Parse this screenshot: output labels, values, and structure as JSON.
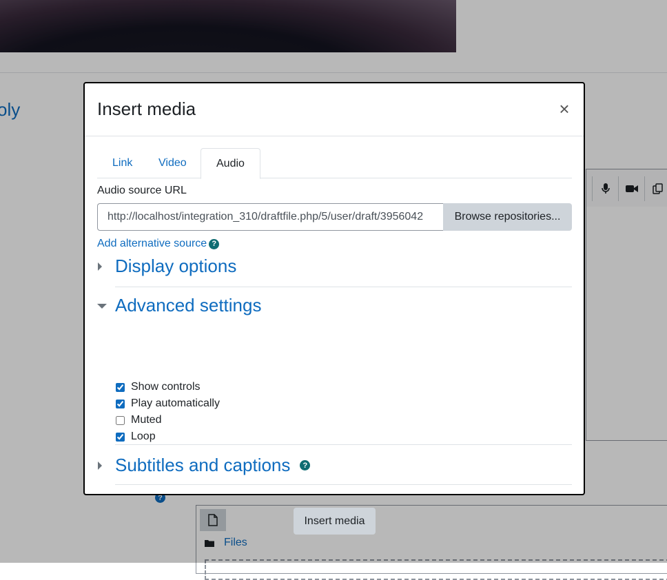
{
  "background": {
    "link_partial": "oly",
    "help_glyph": "?",
    "file_manager": {
      "files_link": "Files"
    },
    "toolbar_icons": [
      "microphone-icon",
      "video-camera-icon",
      "copy-icon"
    ]
  },
  "modal": {
    "title": "Insert media",
    "close_glyph": "×",
    "tabs": [
      {
        "label": "Link",
        "active": false
      },
      {
        "label": "Video",
        "active": false
      },
      {
        "label": "Audio",
        "active": true
      }
    ],
    "audio": {
      "source_label": "Audio source URL",
      "source_value": "http://localhost/integration_310/draftfile.php/5/user/draft/3956042",
      "browse_label": "Browse repositories...",
      "add_alt_label": "Add alternative source",
      "help_glyph": "?"
    },
    "sections": {
      "display": {
        "title": "Display options",
        "expanded": false
      },
      "advanced": {
        "title": "Advanced settings",
        "expanded": true,
        "options": [
          {
            "label": "Show controls",
            "checked": true
          },
          {
            "label": "Play automatically",
            "checked": true
          },
          {
            "label": "Muted",
            "checked": false
          },
          {
            "label": "Loop",
            "checked": true
          }
        ]
      },
      "subtitles": {
        "title": "Subtitles and captions",
        "expanded": false
      }
    },
    "submit_label": "Insert media"
  },
  "colors": {
    "accent": "#0f6cbf",
    "button_bg": "#ced4da",
    "help_bg": "#0f6c72"
  }
}
